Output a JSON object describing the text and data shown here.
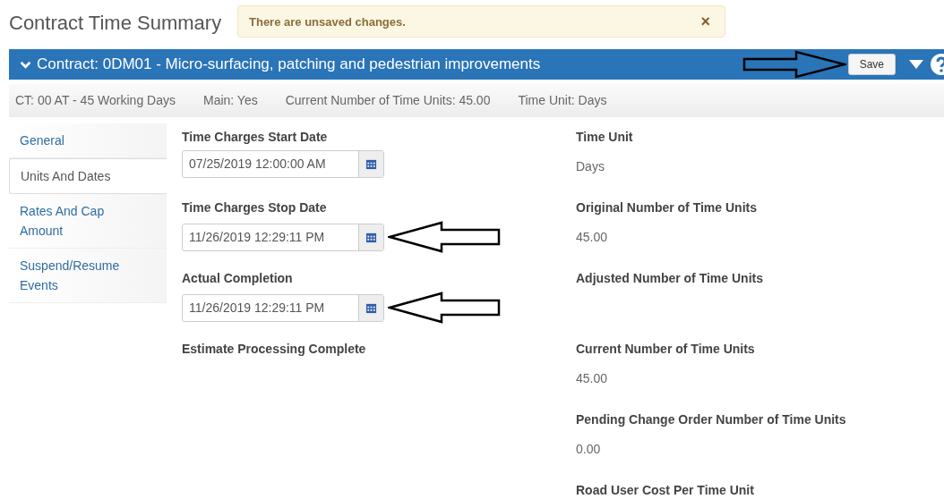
{
  "page_title": "Contract Time Summary",
  "toast": {
    "message": "There are unsaved changes.",
    "close": "×"
  },
  "header": {
    "title": "Contract: 0DM01 - Micro-surfacing, patching and pedestrian improvements",
    "expanded": true,
    "save_button": "Save"
  },
  "info_bar": [
    "CT: 00 AT - 45 Working Days",
    "Main: Yes",
    "Current Number of Time Units: 45.00",
    "Time Unit: Days"
  ],
  "sidebar": {
    "items": [
      {
        "label": "General",
        "selected": false
      },
      {
        "label": "Units And Dates",
        "selected": true
      },
      {
        "label": "Rates And Cap Amount",
        "selected": false
      },
      {
        "label": "Suspend/Resume Events",
        "selected": false
      }
    ]
  },
  "left_fields": [
    {
      "label": "Time Charges Start Date",
      "value": "07/25/2019 12:00:00 AM",
      "annotated": false
    },
    {
      "label": "Time Charges Stop Date",
      "value": "11/26/2019 12:29:11 PM",
      "annotated": true
    },
    {
      "label": "Actual Completion",
      "value": "11/26/2019 12:29:11 PM",
      "annotated": true
    },
    {
      "label": "Estimate Processing Complete"
    }
  ],
  "right_fields": [
    {
      "label": "Time Unit",
      "value": "Days"
    },
    {
      "label": "Original Number of Time Units",
      "value": "45.00"
    },
    {
      "label": "Adjusted Number of Time Units"
    },
    {
      "label": "Current Number of Time Units",
      "value": "45.00"
    },
    {
      "label": "Pending Change Order Number of Time Units",
      "value": "0.00"
    },
    {
      "label": "Road User Cost Per Time Unit"
    }
  ]
}
